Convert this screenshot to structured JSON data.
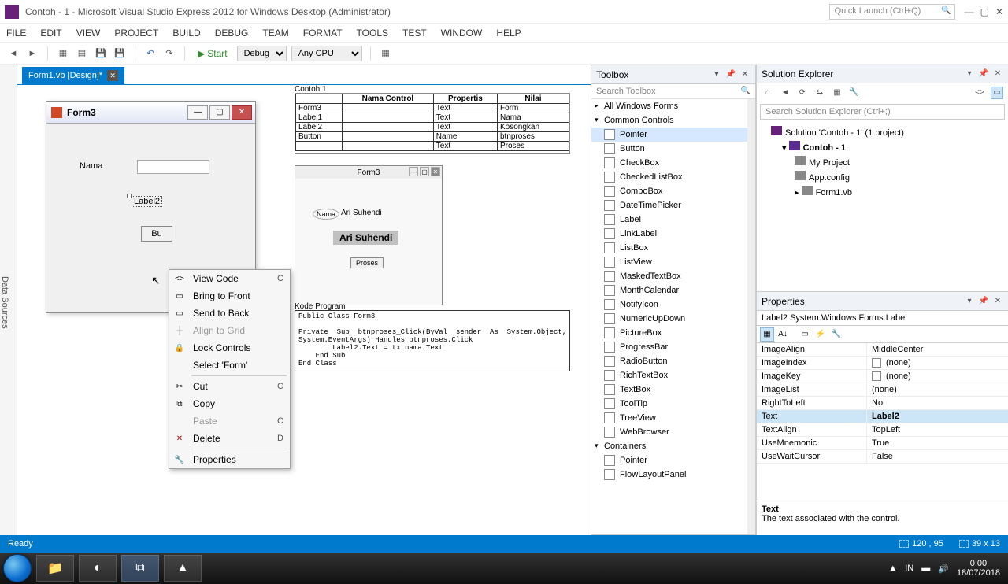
{
  "titlebar": {
    "title": "Contoh - 1 - Microsoft Visual Studio Express 2012 for Windows Desktop (Administrator)",
    "quick_launch_placeholder": "Quick Launch (Ctrl+Q)"
  },
  "menubar": [
    "FILE",
    "EDIT",
    "VIEW",
    "PROJECT",
    "BUILD",
    "DEBUG",
    "TEAM",
    "FORMAT",
    "TOOLS",
    "TEST",
    "WINDOW",
    "HELP"
  ],
  "toolbar": {
    "start": "Start",
    "config": "Debug",
    "platform": "Any CPU"
  },
  "doc_tab": {
    "name": "Form1.vb [Design]*"
  },
  "left_tab": "Data Sources",
  "form": {
    "title": "Form3",
    "label_nama": "Nama",
    "label2": "Label2",
    "button_text": "Bu"
  },
  "context_menu": [
    {
      "label": "View Code",
      "icon": "<>",
      "shortcut": "C"
    },
    {
      "label": "Bring to Front",
      "icon": "▭"
    },
    {
      "label": "Send to Back",
      "icon": "▭"
    },
    {
      "label": "Align to Grid",
      "icon": "┼",
      "disabled": true
    },
    {
      "label": "Lock Controls",
      "icon": "🔒"
    },
    {
      "label": "Select 'Form'",
      "sep_after": true
    },
    {
      "label": "Cut",
      "icon": "✂",
      "shortcut": "C"
    },
    {
      "label": "Copy",
      "icon": "⧉"
    },
    {
      "label": "Paste",
      "icon": "",
      "disabled": true,
      "shortcut": "C"
    },
    {
      "label": "Delete",
      "icon": "✕",
      "shortcut": "D",
      "red": true,
      "sep_after": true
    },
    {
      "label": "Properties",
      "icon": "🔧"
    }
  ],
  "preview": {
    "title": "Contoh 1",
    "headers": [
      "",
      "Nama Control",
      "Propertis",
      "Nilai"
    ],
    "rows": [
      [
        "Form3",
        "",
        "Text",
        "Form"
      ],
      [
        "Label1",
        "",
        "Text",
        "Nama"
      ],
      [
        "Label2",
        "",
        "Text",
        "Kosongkan"
      ],
      [
        "Button",
        "",
        "Name",
        "btnproses"
      ],
      [
        "",
        "",
        "Text",
        "Proses"
      ]
    ]
  },
  "mini_form": {
    "title": "Form3",
    "nama_lbl": "Nama",
    "nama_val": "Ari Suhendi",
    "highlight": "Ari Suhendi",
    "btn": "Proses"
  },
  "code_title": "Kode Program",
  "code": "Public Class Form3\n\nPrivate  Sub  btnproses_Click(ByVal  sender  As  System.Object,  ByVal  e  As\nSystem.EventArgs) Handles btnproses.Click\n        Label2.Text = txtnama.Text\n    End Sub\nEnd Class",
  "toolbox": {
    "title": "Toolbox",
    "search": "Search Toolbox",
    "group_all": "All Windows Forms",
    "group_common": "Common Controls",
    "common_items": [
      "Pointer",
      "Button",
      "CheckBox",
      "CheckedListBox",
      "ComboBox",
      "DateTimePicker",
      "Label",
      "LinkLabel",
      "ListBox",
      "ListView",
      "MaskedTextBox",
      "MonthCalendar",
      "NotifyIcon",
      "NumericUpDown",
      "PictureBox",
      "ProgressBar",
      "RadioButton",
      "RichTextBox",
      "TextBox",
      "ToolTip",
      "TreeView",
      "WebBrowser"
    ],
    "group_containers": "Containers",
    "container_items": [
      "Pointer",
      "FlowLayoutPanel"
    ]
  },
  "solution": {
    "title": "Solution Explorer",
    "search": "Search Solution Explorer (Ctrl+;)",
    "root": "Solution 'Contoh - 1' (1 project)",
    "project": "Contoh - 1",
    "items": [
      "My Project",
      "App.config",
      "Form1.vb"
    ]
  },
  "properties": {
    "title": "Properties",
    "object": "Label2  System.Windows.Forms.Label",
    "rows": [
      {
        "name": "ImageAlign",
        "value": "MiddleCenter"
      },
      {
        "name": "ImageIndex",
        "value": "(none)",
        "box": true
      },
      {
        "name": "ImageKey",
        "value": "(none)",
        "box": true
      },
      {
        "name": "ImageList",
        "value": "(none)"
      },
      {
        "name": "RightToLeft",
        "value": "No"
      },
      {
        "name": "Text",
        "value": "Label2",
        "sel": true
      },
      {
        "name": "TextAlign",
        "value": "TopLeft"
      },
      {
        "name": "UseMnemonic",
        "value": "True"
      },
      {
        "name": "UseWaitCursor",
        "value": "False"
      }
    ],
    "desc_title": "Text",
    "desc": "The text associated with the control."
  },
  "statusbar": {
    "ready": "Ready",
    "pos": "120 , 95",
    "size": "39 x 13"
  },
  "taskbar": {
    "lang": "IN",
    "time": "0:00",
    "date": "18/07/2018"
  }
}
